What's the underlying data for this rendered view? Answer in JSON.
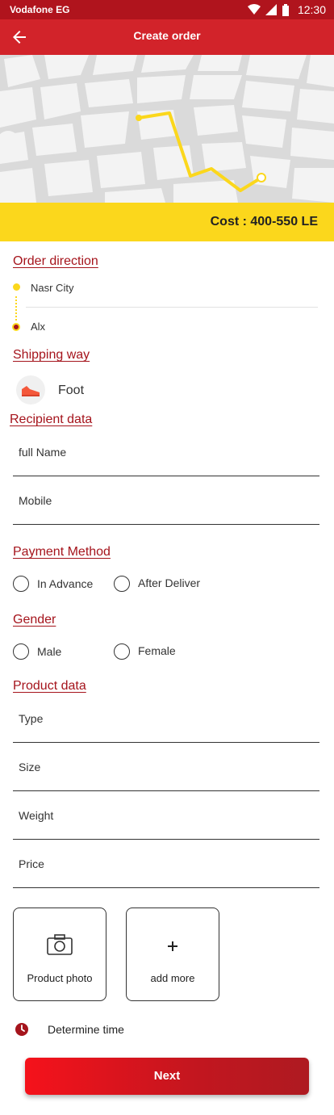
{
  "status_bar": {
    "carrier": "Vodafone EG",
    "time": "12:30"
  },
  "app_bar": {
    "title": "Create order",
    "back_icon": "arrow-left-icon"
  },
  "cost": "Cost : 400-550 LE",
  "colors": {
    "primary": "#d2232a",
    "accent_yellow": "#fbd71c",
    "section_title": "#a5141c"
  },
  "order_direction": {
    "title": "Order direction",
    "from": "Nasr City",
    "to": "Alx"
  },
  "shipping": {
    "title": "Shipping way",
    "method": "Foot",
    "icon": "shoe-icon"
  },
  "recipient": {
    "title": "Recipient data",
    "full_name_placeholder": "full Name",
    "mobile_placeholder": "Mobile"
  },
  "payment": {
    "title": "Payment Method",
    "options": [
      "In Advance",
      "After Deliver"
    ]
  },
  "gender": {
    "title": "Gender",
    "options": [
      "Male",
      "Female"
    ]
  },
  "product": {
    "title": "Product data",
    "type_placeholder": "Type",
    "size_placeholder": "Size",
    "weight_placeholder": "Weight",
    "price_placeholder": "Price",
    "photo_label": "Product photo",
    "add_more_label": "add more"
  },
  "determine_time": "Determine time",
  "next_label": "Next"
}
